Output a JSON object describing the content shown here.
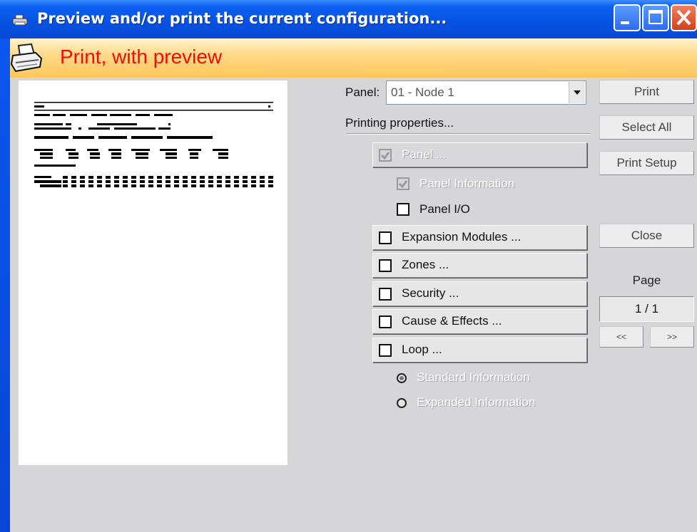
{
  "window": {
    "title": "Preview and/or print the current configuration...",
    "title_icon": "printer-icon",
    "controls": [
      "minimize-icon",
      "maximize-icon",
      "close-icon"
    ]
  },
  "header": {
    "title": "Print, with preview",
    "icon": "printer-icon",
    "title_color": "#e8100c",
    "band_color": "#ffd98a"
  },
  "panel_select": {
    "label": "Panel:",
    "value": "01 - Node 1"
  },
  "printing_properties_label": "Printing properties...",
  "sections": {
    "panel": {
      "label": "Panel ...",
      "checked": true,
      "enabled": false
    },
    "panel_information": {
      "label": "Panel Information",
      "checked": true,
      "enabled": false
    },
    "panel_io": {
      "label": "Panel I/O",
      "checked": false,
      "enabled": true
    },
    "expansion_modules": {
      "label": "Expansion Modules ...",
      "checked": false,
      "enabled": true
    },
    "zones": {
      "label": "Zones ...",
      "checked": false,
      "enabled": true
    },
    "security": {
      "label": "Security ...",
      "checked": false,
      "enabled": true
    },
    "cause_effects": {
      "label": "Cause & Effects ...",
      "checked": false,
      "enabled": true
    },
    "loop": {
      "label": "Loop ...",
      "checked": false,
      "enabled": true
    }
  },
  "loop_options": {
    "standard": {
      "label": "Standard Information",
      "selected": true,
      "enabled": false
    },
    "expanded": {
      "label": "Expanded Information",
      "selected": false,
      "enabled": false
    }
  },
  "buttons": {
    "print": "Print",
    "select_all": "Select All",
    "print_setup": "Print Setup",
    "close": "Close",
    "prev": "<<",
    "next": ">>"
  },
  "page": {
    "label": "Page",
    "value": "1 / 1"
  }
}
